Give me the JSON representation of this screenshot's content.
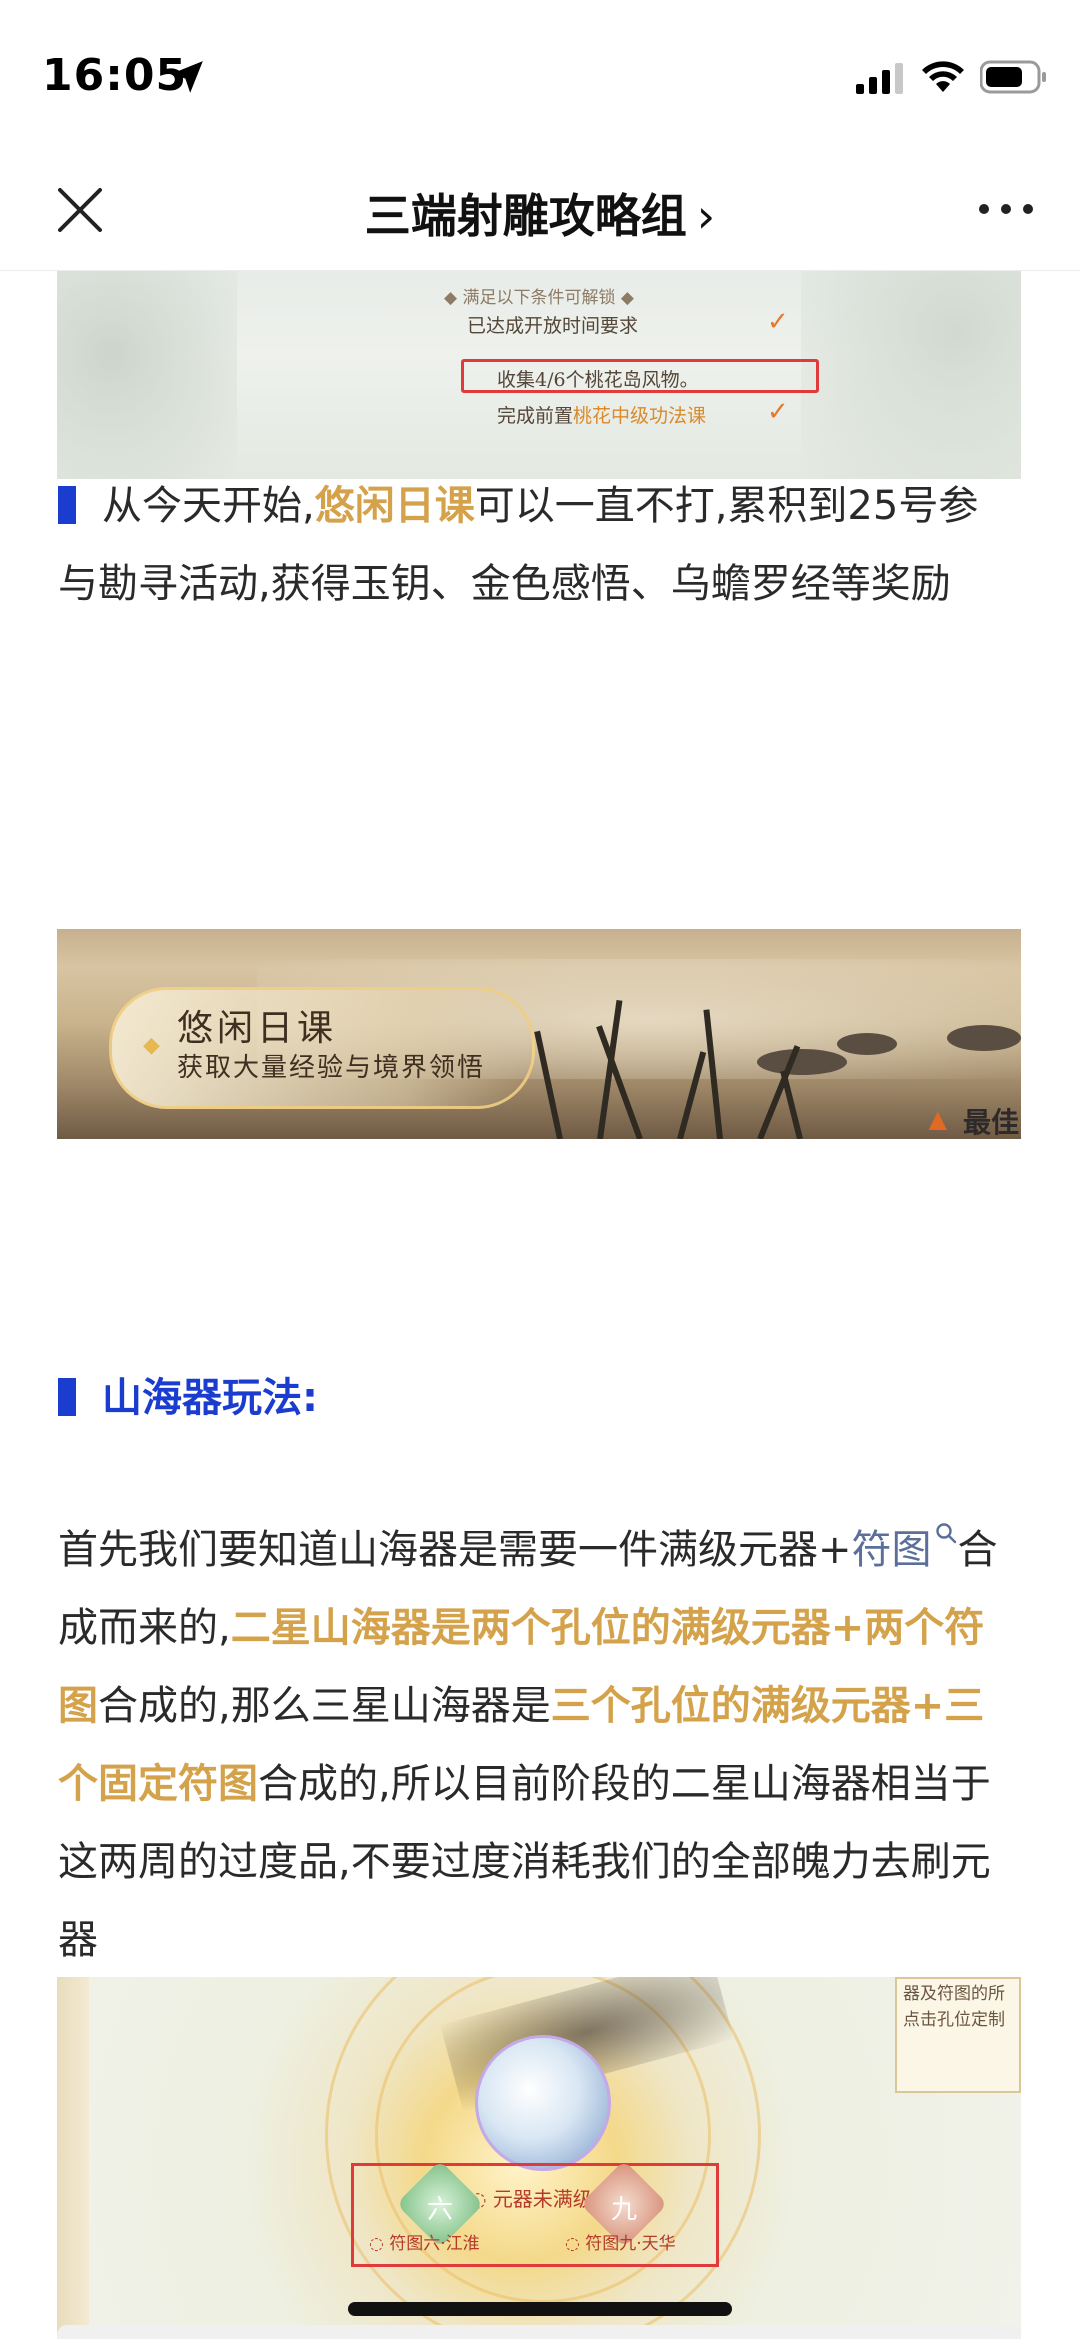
{
  "status_bar": {
    "time": "16:05"
  },
  "nav": {
    "title": "三端射雕攻略组",
    "chevron": "›"
  },
  "image1": {
    "condition_title": "满足以下条件可解锁",
    "rows": [
      {
        "text": "已达成开放时间要求",
        "checked": true
      },
      {
        "text": "收集4/6个桃花岛风物。",
        "checked": false
      },
      {
        "text_prefix": "完成前置",
        "text_highlight": "桃花中级功法课",
        "checked": true
      }
    ]
  },
  "paragraph1": {
    "part1": "从今天开始,",
    "highlight": "悠闲日课",
    "part2": "可以一直不打,累积到25号参与勘寻活动,获得玉钥、金色感悟、乌蟾罗经等奖励"
  },
  "image2": {
    "badge_title": "悠闲日课",
    "badge_subtitle": "获取大量经验与境界领悟",
    "corner_text": "最佳"
  },
  "section": {
    "title": "山海器玩法:"
  },
  "paragraph2": {
    "p1": "首先我们要知道山海器是需要一件满级元器+",
    "link": "符图",
    "p2": "合成而来的,",
    "h1": "二星山海器是两个孔位的满级元器+两个符图",
    "p3": "合成的,那么三星山海器是",
    "h2": "三个孔位的满级元器+三个固定符图",
    "p4": "合成的,所以目前阶段的二星山海器相当于这两周的过度品,不要过度消耗我们的全部魄力去刷元器"
  },
  "image3": {
    "status_label": "元器未满级",
    "gem_left_char": "六",
    "gem_right_char": "九",
    "gem_left_label": "符图六·江淮",
    "gem_right_label": "符图九·天华",
    "note_lines": [
      "器及符图的所",
      "点击孔位定制"
    ]
  },
  "colors": {
    "accent_blue": "#1a3ccf",
    "highlight_gold": "#d4a24a",
    "link_blue": "#5b6f9a",
    "red_box": "#e03a3a"
  }
}
